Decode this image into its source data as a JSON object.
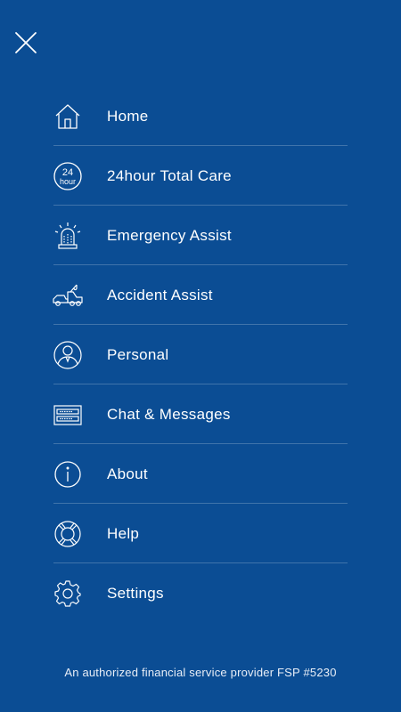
{
  "colors": {
    "background": "#0b4d94",
    "text": "#ffffff",
    "divider": "rgba(255,255,255,0.22)"
  },
  "close_icon": "close-icon",
  "menu": {
    "items": [
      {
        "label": "Home",
        "icon": "home-icon"
      },
      {
        "label": "24hour Total Care",
        "icon": "24hour-icon",
        "icon_text": {
          "top": "24",
          "bottom": "hour"
        }
      },
      {
        "label": "Emergency Assist",
        "icon": "emergency-beacon-icon"
      },
      {
        "label": "Accident Assist",
        "icon": "tow-truck-icon"
      },
      {
        "label": "Personal",
        "icon": "person-icon"
      },
      {
        "label": "Chat & Messages",
        "icon": "chat-messages-icon"
      },
      {
        "label": "About",
        "icon": "info-icon"
      },
      {
        "label": "Help",
        "icon": "lifebuoy-icon"
      },
      {
        "label": "Settings",
        "icon": "gear-icon"
      }
    ]
  },
  "footer": {
    "text": "An authorized financial service provider FSP #5230"
  }
}
